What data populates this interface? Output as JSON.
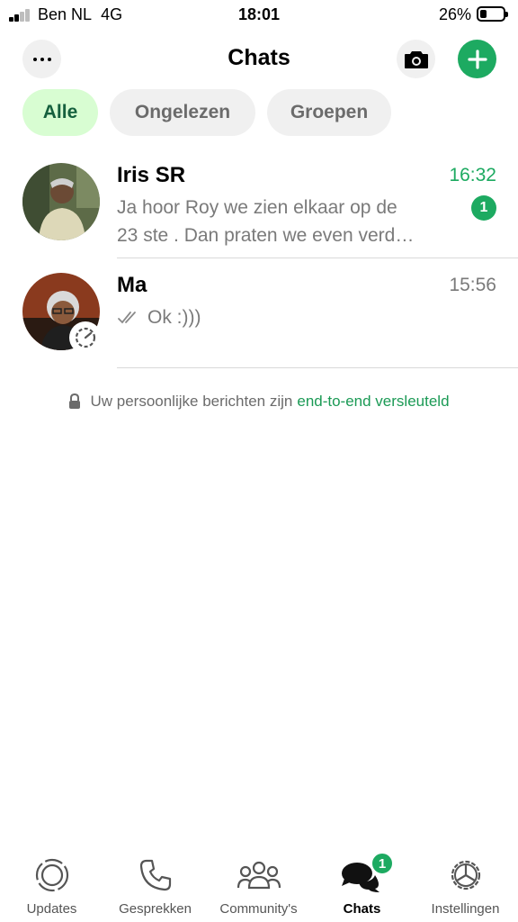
{
  "status_bar": {
    "carrier": "Ben NL",
    "network": "4G",
    "time": "18:01",
    "battery": "26%"
  },
  "header": {
    "title": "Chats",
    "menu_icon": "more-horizontal-icon",
    "camera_icon": "camera-icon",
    "new_chat_icon": "plus-icon"
  },
  "filters": [
    {
      "label": "Alle",
      "active": true
    },
    {
      "label": "Ongelezen",
      "active": false
    },
    {
      "label": "Groepen",
      "active": false
    }
  ],
  "chats": [
    {
      "name": "Iris SR",
      "time": "16:32",
      "message_line1": "Ja hoor Roy we zien elkaar op de",
      "message_line2": "23 ste . Dan praten we even verd…",
      "unread_count": "1"
    },
    {
      "name": "Ma",
      "time": "15:56",
      "message": "Ok :)))",
      "status": "read"
    }
  ],
  "encryption_notice": {
    "text": "Uw persoonlijke berichten zijn",
    "link": "end-to-end versleuteld"
  },
  "tabs": [
    {
      "label": "Updates",
      "icon": "updates-icon",
      "active": false
    },
    {
      "label": "Gesprekken",
      "icon": "phone-icon",
      "active": false
    },
    {
      "label": "Community's",
      "icon": "community-icon",
      "active": false
    },
    {
      "label": "Chats",
      "icon": "chats-icon",
      "active": true,
      "badge": "1"
    },
    {
      "label": "Instellingen",
      "icon": "settings-icon",
      "active": false
    }
  ],
  "colors": {
    "accent": "#1daa61",
    "chip_active_bg": "#d8fdd2",
    "chip_active_text": "#15603e",
    "chip_bg": "#f0f0f0",
    "muted_text": "#7a7a7a"
  }
}
